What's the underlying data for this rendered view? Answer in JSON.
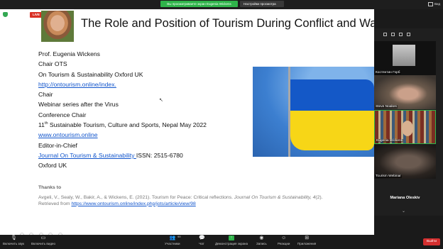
{
  "topbar": {
    "share_banner": "Вы просматриваете экран Eugenia Wickens",
    "view_options": "Настройки просмотра",
    "view_label": "Вид"
  },
  "slide": {
    "live_label": "LIVE",
    "youtube_label": "YouTube",
    "title": "The Role and Position of Tourism During Conflict and War",
    "lines": {
      "l1": "Prof. Eugenia Wickens",
      "l2": "Chair OTS",
      "l3": "On Tourism & Sustainability Oxford UK",
      "l4": "http://ontourism.online/index.",
      "l5": "Chair",
      "l6": "Webinar series after the Virus",
      "l7": "Conference Chair",
      "l8_num": "11",
      "l8_sup": "th",
      "l8_rest": " Sustainable Tourism, Culture and Sports, Nepal May  2022",
      "l9": "www.ontourism.online",
      "l10": "Editor-in-Chief",
      "l11_link": "Journal On Tourism & Sustainability ",
      "l11_rest": "ISSN:  2515-6780",
      "l12": "Oxford UK"
    },
    "thanks": "Thanks to",
    "ref_authors": "Avgeli, V., Sealy, W., Bakir, A., & Wickens, E. (2021).",
    "ref_title": " Tourism for Peace: Critical reflections. ",
    "ref_journal": "Journal On Tourism & Sustainability, 4",
    "ref_issue": "(2).",
    "ref_retrieved": "Retrieved from ",
    "ref_url": "https://www.ontourism.online/index.php/jots/article/view/98"
  },
  "panel": {
    "participants": [
      {
        "name": "Костянтин Горб"
      },
      {
        "name": "Steve Noakes"
      },
      {
        "name": "Eugenia Wickens"
      },
      {
        "name": "Tourism Webinar"
      }
    ],
    "active_speaker": "Mariana Oleskiv"
  },
  "bottombar": {
    "mute": "Включить звук",
    "video": "Включить видео",
    "participants": "Участники",
    "participants_count": "99",
    "chat": "Чат",
    "share": "Демонстрация экрана",
    "record": "Запись",
    "reactions": "Реакции",
    "apps": "Приложения",
    "leave": "Выйти"
  }
}
